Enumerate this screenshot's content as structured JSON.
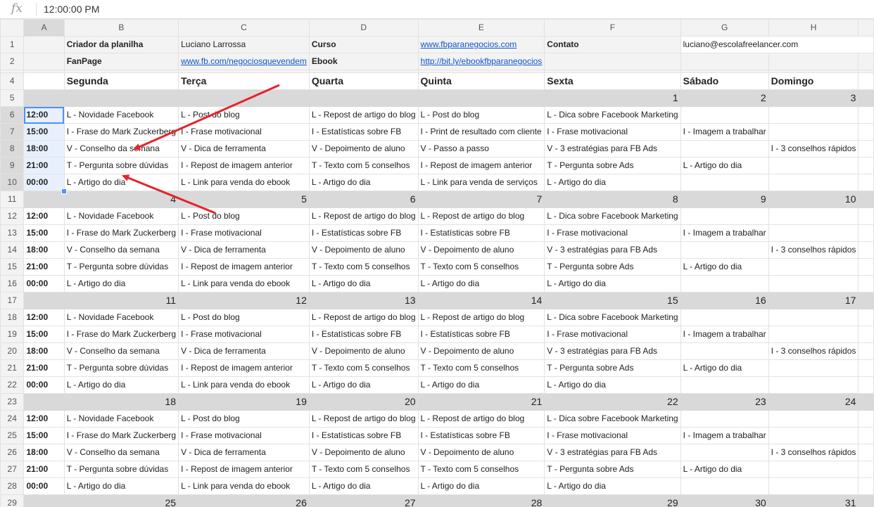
{
  "formula_bar": {
    "icon": "fx-icon",
    "value": "12:00:00 PM"
  },
  "columns": [
    "A",
    "B",
    "C",
    "D",
    "E",
    "F",
    "G",
    "H"
  ],
  "header": {
    "creator_label": "Criador da planilha",
    "creator_name": "Luciano Larrossa",
    "course_label": "Curso",
    "course_link": "www.fbparanegocios.com",
    "contact_label": "Contato",
    "contact_email": "luciano@escolafreelancer.com",
    "fanpage_label": "FanPage",
    "fanpage_link": "www.fb.com/negociosquevendem",
    "ebook_label": "Ebook",
    "ebook_link": "http://bit.ly/ebookfbparanegocios"
  },
  "days": [
    "Segunda",
    "Terça",
    "Quarta",
    "Quinta",
    "Sexta",
    "Sábado",
    "Domingo"
  ],
  "weeks": [
    {
      "row_start": 5,
      "dates": [
        "",
        "",
        "",
        "",
        "1",
        "2",
        "3"
      ],
      "slots": [
        {
          "time": "12:00",
          "cells": [
            "L - Novidade Facebook",
            "L - Post do blog",
            "L - Repost de artigo do blog",
            "L - Post do blog",
            "L - Dica sobre Facebook Marketing",
            "",
            ""
          ]
        },
        {
          "time": "15:00",
          "cells": [
            "I - Frase do Mark Zuckerberg",
            "I - Frase motivacional",
            "I - Estatísticas sobre FB",
            "I - Print de resultado com cliente",
            "I - Frase motivacional",
            "I - Imagem a trabalhar",
            ""
          ]
        },
        {
          "time": "18:00",
          "cells": [
            "V - Conselho da semana",
            "V - Dica de ferramenta",
            "V - Depoimento de aluno",
            "V - Passo a passo",
            "V - 3 estratégias para FB Ads",
            "",
            "I - 3 conselhos rápidos"
          ]
        },
        {
          "time": "21:00",
          "cells": [
            "T - Pergunta sobre dúvidas",
            "I - Repost de imagem anterior",
            "T - Texto com 5 conselhos",
            "I - Repost de imagem anterior",
            "T - Pergunta sobre Ads",
            "L - Artigo do dia",
            ""
          ]
        },
        {
          "time": "00:00",
          "cells": [
            "L - Artigo do dia",
            "L - Link para venda do ebook",
            "L - Artigo do dia",
            "L - Link para venda de serviços",
            "L - Artigo do dia",
            "",
            ""
          ]
        }
      ]
    },
    {
      "row_start": 11,
      "dates": [
        "4",
        "5",
        "6",
        "7",
        "8",
        "9",
        "10"
      ],
      "slots": [
        {
          "time": "12:00",
          "cells": [
            "L - Novidade Facebook",
            "L - Post do blog",
            "L - Repost de artigo do blog",
            "L - Repost de artigo do blog",
            "L - Dica sobre Facebook Marketing",
            "",
            ""
          ]
        },
        {
          "time": "15:00",
          "cells": [
            "I - Frase do Mark Zuckerberg",
            "I - Frase motivacional",
            "I - Estatísticas sobre FB",
            "I - Estatísticas sobre FB",
            "I - Frase motivacional",
            "I - Imagem a trabalhar",
            ""
          ]
        },
        {
          "time": "18:00",
          "cells": [
            "V - Conselho da semana",
            "V - Dica de ferramenta",
            "V - Depoimento de aluno",
            "V - Depoimento de aluno",
            "V - 3 estratégias para FB Ads",
            "",
            "I - 3 conselhos rápidos"
          ]
        },
        {
          "time": "21:00",
          "cells": [
            "T - Pergunta sobre dúvidas",
            "I - Repost de imagem anterior",
            "T - Texto com 5 conselhos",
            "T - Texto com 5 conselhos",
            "T - Pergunta sobre Ads",
            "L - Artigo do dia",
            ""
          ]
        },
        {
          "time": "00:00",
          "cells": [
            "L - Artigo do dia",
            "L - Link para venda do ebook",
            "L - Artigo do dia",
            "L - Artigo do dia",
            "L - Artigo do dia",
            "",
            ""
          ]
        }
      ]
    },
    {
      "row_start": 17,
      "dates": [
        "11",
        "12",
        "13",
        "14",
        "15",
        "16",
        "17"
      ],
      "slots": [
        {
          "time": "12:00",
          "cells": [
            "L - Novidade Facebook",
            "L - Post do blog",
            "L - Repost de artigo do blog",
            "L - Repost de artigo do blog",
            "L - Dica sobre Facebook Marketing",
            "",
            ""
          ]
        },
        {
          "time": "15:00",
          "cells": [
            "I - Frase do Mark Zuckerberg",
            "I - Frase motivacional",
            "I - Estatísticas sobre FB",
            "I - Estatísticas sobre FB",
            "I - Frase motivacional",
            "I - Imagem a trabalhar",
            ""
          ]
        },
        {
          "time": "18:00",
          "cells": [
            "V - Conselho da semana",
            "V - Dica de ferramenta",
            "V - Depoimento de aluno",
            "V - Depoimento de aluno",
            "V - 3 estratégias para FB Ads",
            "",
            "I - 3 conselhos rápidos"
          ]
        },
        {
          "time": "21:00",
          "cells": [
            "T - Pergunta sobre dúvidas",
            "I - Repost de imagem anterior",
            "T - Texto com 5 conselhos",
            "T - Texto com 5 conselhos",
            "T - Pergunta sobre Ads",
            "L - Artigo do dia",
            ""
          ]
        },
        {
          "time": "00:00",
          "cells": [
            "L - Artigo do dia",
            "L - Link para venda do ebook",
            "L - Artigo do dia",
            "L - Artigo do dia",
            "L - Artigo do dia",
            "",
            ""
          ]
        }
      ]
    },
    {
      "row_start": 23,
      "dates": [
        "18",
        "19",
        "20",
        "21",
        "22",
        "23",
        "24"
      ],
      "slots": [
        {
          "time": "12:00",
          "cells": [
            "L - Novidade Facebook",
            "L - Post do blog",
            "L - Repost de artigo do blog",
            "L - Repost de artigo do blog",
            "L - Dica sobre Facebook Marketing",
            "",
            ""
          ]
        },
        {
          "time": "15:00",
          "cells": [
            "I - Frase do Mark Zuckerberg",
            "I - Frase motivacional",
            "I - Estatísticas sobre FB",
            "I - Estatísticas sobre FB",
            "I - Frase motivacional",
            "I - Imagem a trabalhar",
            ""
          ]
        },
        {
          "time": "18:00",
          "cells": [
            "V - Conselho da semana",
            "V - Dica de ferramenta",
            "V - Depoimento de aluno",
            "V - Depoimento de aluno",
            "V - 3 estratégias para FB Ads",
            "",
            "I - 3 conselhos rápidos"
          ]
        },
        {
          "time": "21:00",
          "cells": [
            "T - Pergunta sobre dúvidas",
            "I - Repost de imagem anterior",
            "T - Texto com 5 conselhos",
            "T - Texto com 5 conselhos",
            "T - Pergunta sobre Ads",
            "L - Artigo do dia",
            ""
          ]
        },
        {
          "time": "00:00",
          "cells": [
            "L - Artigo do dia",
            "L - Link para venda do ebook",
            "L - Artigo do dia",
            "L - Artigo do dia",
            "L - Artigo do dia",
            "",
            ""
          ]
        }
      ]
    }
  ],
  "next_row_dates": [
    "25",
    "26",
    "27",
    "28",
    "29",
    "30",
    "31"
  ],
  "colors": {
    "accent": "#4d90fe",
    "selection": "#e8f0fe",
    "link": "#1155cc",
    "date_band": "#d9d9d9",
    "arrow": "#e8222a"
  }
}
